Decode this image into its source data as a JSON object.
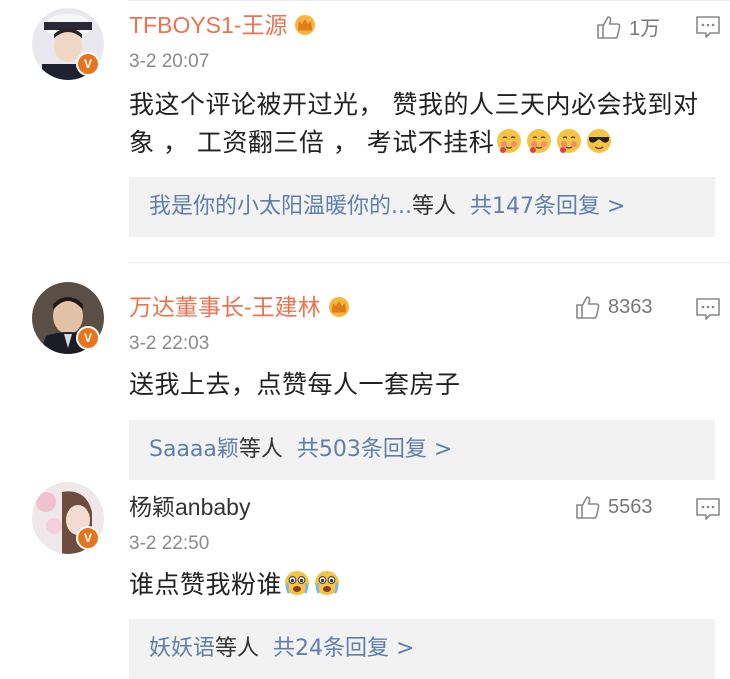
{
  "comments": [
    {
      "name": "TFBOYS1-王源",
      "vip": true,
      "time": "3-2 20:07",
      "text": "我这个评论被开过光， 赞我的人三天内必会找到对象 ， 工资翻三倍 ， 考试不挂科",
      "emojis": [
        "shy-emoji",
        "shy-emoji",
        "shy-emoji",
        "cool-emoji"
      ],
      "likes": "1万",
      "reply": {
        "who": "我是你的小太阳温暖你的...",
        "rest": "等人",
        "count": "共147条回复 >"
      }
    },
    {
      "name": "万达董事长-王建林",
      "vip": true,
      "time": "3-2 22:03",
      "text": "送我上去，点赞每人一套房子",
      "emojis": [],
      "likes": "8363",
      "reply": {
        "who": "Saaaa颖",
        "rest": "等人",
        "count": "共503条回复 >"
      }
    },
    {
      "name": "杨颖anbaby",
      "vip": false,
      "time": "3-2 22:50",
      "text": "谁点赞我粉谁",
      "emojis": [
        "crying-emoji",
        "crying-emoji"
      ],
      "likes": "5563",
      "reply": {
        "who": "妖妖语",
        "rest": "等人",
        "count": "共24条回复 >"
      }
    }
  ],
  "colors": {
    "vip_name": "#eb7350",
    "link": "#5d7fae",
    "badge": "#e5761f"
  }
}
